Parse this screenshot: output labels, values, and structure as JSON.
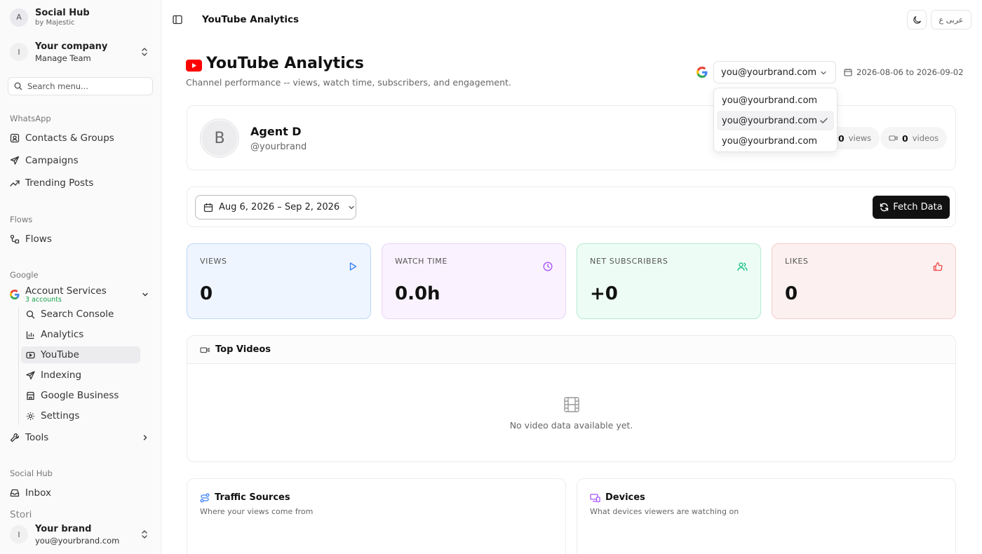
{
  "sidebar": {
    "brand": {
      "avatar": "A",
      "name": "Social Hub",
      "sub": "by Majestic"
    },
    "company": {
      "avatar": "I",
      "name": "Your company",
      "sub": "Manage Team"
    },
    "search_placeholder": "Search menu...",
    "sections": {
      "whatsapp": "WhatsApp",
      "flows": "Flows",
      "google": "Google",
      "social": "Social Hub"
    },
    "items": {
      "contacts": "Contacts & Groups",
      "campaigns": "Campaigns",
      "trending": "Trending Posts",
      "flows": "Flows",
      "account_services": "Account Services",
      "account_services_sub": "3 accounts",
      "search_console": "Search Console",
      "analytics": "Analytics",
      "youtube": "YouTube",
      "indexing": "Indexing",
      "google_business": "Google Business",
      "settings": "Settings",
      "tools": "Tools",
      "inbox": "Inbox",
      "stories": "Stori"
    },
    "user": {
      "avatar": "I",
      "name": "Your brand",
      "email": "you@yourbrand.com"
    }
  },
  "topbar": {
    "title": "YouTube Analytics",
    "lang": "عربى ع"
  },
  "header": {
    "title": "YouTube Analytics",
    "subtitle": "Channel performance -- views, watch time, subscribers, and engagement.",
    "account": "you@yourbrand.com",
    "date_range": "2026-08-06 to 2026-09-02"
  },
  "dropdown": {
    "options": [
      "you@yourbrand.com",
      "you@yourbrand.com",
      "you@yourbrand.com"
    ],
    "selected_index": 1
  },
  "profile": {
    "avatar": "B",
    "name": "Agent D",
    "handle": "@yourbrand",
    "views_count": "0",
    "views_label": "views",
    "videos_count": "0",
    "videos_label": "videos"
  },
  "filter": {
    "date_range": "Aug 6, 2026 – Sep 2, 2026",
    "fetch_label": "Fetch Data"
  },
  "stats": [
    {
      "label": "VIEWS",
      "value": "0",
      "color": "#3b82f6",
      "bg": "#eef5ff",
      "border": "#bcd6f7",
      "icon": "play-icon"
    },
    {
      "label": "WATCH TIME",
      "value": "0.0h",
      "color": "#a855f7",
      "bg": "#faf3ff",
      "border": "#e8d3f7",
      "icon": "clock-icon"
    },
    {
      "label": "NET SUBSCRIBERS",
      "value": "+0",
      "color": "#10b981",
      "bg": "#edfdf5",
      "border": "#b4ead0",
      "icon": "users-icon"
    },
    {
      "label": "LIKES",
      "value": "0",
      "color": "#ef4444",
      "bg": "#fdf0f0",
      "border": "#f5cccc",
      "icon": "thumbs-up-icon"
    }
  ],
  "top_videos": {
    "title": "Top Videos",
    "empty": "No video data available yet."
  },
  "traffic": {
    "title": "Traffic Sources",
    "sub": "Where your views come from"
  },
  "devices": {
    "title": "Devices",
    "sub": "What devices viewers are watching on"
  }
}
